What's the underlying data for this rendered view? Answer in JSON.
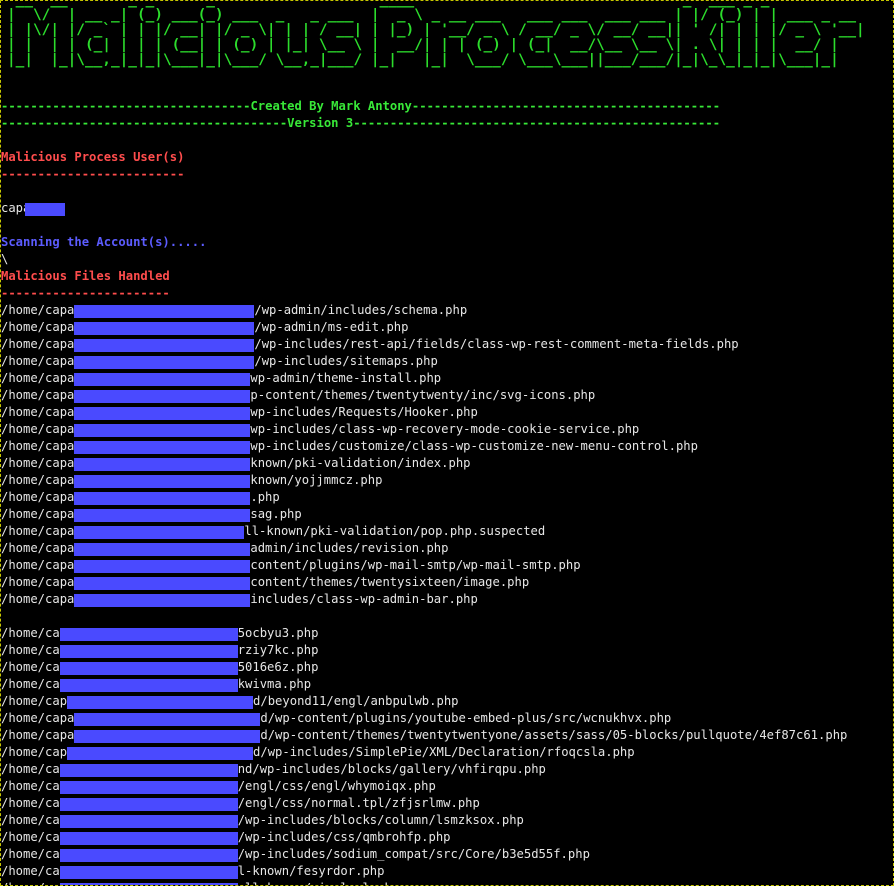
{
  "banner": {
    "ascii_art": " __  __       _ _      _                   ____                               _  ___ _ _\n|  \\/  | __ _| (_) ___(_) ___  _   _ ___  |  _ \\ _ __ ___   ___ ___  ___ ___ | |/ (_) | | ___ _ __\n| |\\/| |/ _` | | |/ __| |/ _ \\| | | / __| | |_) | '__/ _ \\ / __/ _ \\/ __/ __|| ' /| | | |/ _ \\ '__|\n| |  | | (_| | | | (__| | (_) | |_| \\__ \\ |  __/| | | (_) | (_|  __/\\__ \\__ \\| . \\| | | |  __/ |\n|_|  |_|\\__,_|_|_|\\___|_|\\___/ \\__,_|___/ |_|   |_|  \\___/ \\___\\___||___/___/|_|\\_\\_|_|_|\\___|_|"
  },
  "credits_line": "----------------------------------Created By Mark Antony------------------------------------------",
  "version_line": "---------------------------------------Version 3--------------------------------------------------",
  "users_section": {
    "heading": "Malicious Process User(s)",
    "underline": "-------------------------",
    "user": "capa"
  },
  "scan_status": "Scanning the Account(s).....",
  "spinner": "\\",
  "files_section": {
    "heading": "Malicious Files Handled",
    "underline": "-----------------------"
  },
  "files_group_1": [
    {
      "prefix": "/home/capa",
      "suffix": "/wp-admin/includes/schema.php"
    },
    {
      "prefix": "/home/capa",
      "suffix": "/wp-admin/ms-edit.php"
    },
    {
      "prefix": "/home/capa",
      "suffix": "/wp-includes/rest-api/fields/class-wp-rest-comment-meta-fields.php"
    },
    {
      "prefix": "/home/capa",
      "suffix": "/wp-includes/sitemaps.php"
    },
    {
      "prefix": "/home/capa",
      "suffix": "wp-admin/theme-install.php"
    },
    {
      "prefix": "/home/capa",
      "suffix": "p-content/themes/twentytwenty/inc/svg-icons.php"
    },
    {
      "prefix": "/home/capa",
      "suffix": "wp-includes/Requests/Hooker.php"
    },
    {
      "prefix": "/home/capa",
      "suffix": "wp-includes/class-wp-recovery-mode-cookie-service.php"
    },
    {
      "prefix": "/home/capa",
      "suffix": "wp-includes/customize/class-wp-customize-new-menu-control.php"
    },
    {
      "prefix": "/home/capa",
      "suffix": "known/pki-validation/index.php"
    },
    {
      "prefix": "/home/capa",
      "suffix": "known/yojjmmcz.php"
    },
    {
      "prefix": "/home/capa",
      "suffix": ".php"
    },
    {
      "prefix": "/home/capa",
      "suffix": "sag.php"
    },
    {
      "prefix": "/home/capa",
      "suffix": "ll-known/pki-validation/pop.php.suspected"
    },
    {
      "prefix": "/home/capa",
      "suffix": "admin/includes/revision.php"
    },
    {
      "prefix": "/home/capa",
      "suffix": "content/plugins/wp-mail-smtp/wp-mail-smtp.php"
    },
    {
      "prefix": "/home/capa",
      "suffix": "content/themes/twentysixteen/image.php"
    },
    {
      "prefix": "/home/capa",
      "suffix": "includes/class-wp-admin-bar.php"
    }
  ],
  "files_group_2": [
    {
      "prefix": "/home/ca",
      "suffix": "5ocbyu3.php"
    },
    {
      "prefix": "/home/ca",
      "suffix": "rziy7kc.php"
    },
    {
      "prefix": "/home/ca",
      "suffix": "5016e6z.php"
    },
    {
      "prefix": "/home/ca",
      "suffix": "kwivma.php"
    },
    {
      "prefix": "/home/cap",
      "suffix": "d/beyond11/engl/anbpulwb.php"
    },
    {
      "prefix": "/home/capa",
      "suffix": "d/wp-content/plugins/youtube-embed-plus/src/wcnukhvx.php"
    },
    {
      "prefix": "/home/capa",
      "suffix": "d/wp-content/themes/twentytwentyone/assets/sass/05-blocks/pullquote/4ef87c61.php"
    },
    {
      "prefix": "/home/cap",
      "suffix": "d/wp-includes/SimplePie/XML/Declaration/rfoqcsla.php"
    },
    {
      "prefix": "/home/ca",
      "suffix": "nd/wp-includes/blocks/gallery/vhfirqpu.php"
    },
    {
      "prefix": "/home/ca",
      "suffix": "/engl/css/engl/whymoiqx.php"
    },
    {
      "prefix": "/home/ca",
      "suffix": "/engl/css/normal.tpl/zfjsrlmw.php"
    },
    {
      "prefix": "/home/ca",
      "suffix": "/wp-includes/blocks/column/lsmzksox.php"
    },
    {
      "prefix": "/home/ca",
      "suffix": "/wp-includes/css/qmbrohfp.php"
    },
    {
      "prefix": "/home/ca",
      "suffix": "/wp-includes/sodium_compat/src/Core/b3e5d55f.php"
    },
    {
      "prefix": "/home/ca",
      "suffix": "l-known/fesyrdor.php"
    },
    {
      "prefix": "/home/ca",
      "suffix": "ell-known/sigalgul.php"
    }
  ],
  "colors": {
    "background": "#000000",
    "banner": "#2cdc2c",
    "section_heading": "#ff4d4d",
    "status": "#5c5cff",
    "text": "#e6e6e6",
    "redaction": "#4a4aff",
    "border": "#c7c700"
  }
}
